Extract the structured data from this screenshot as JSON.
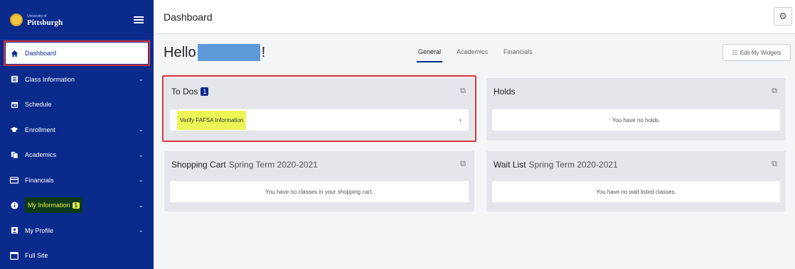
{
  "sidebar": {
    "logo_small": "University of",
    "logo_big": "Pittsburgh",
    "items": [
      {
        "label": "Dashboard"
      },
      {
        "label": "Class Information"
      },
      {
        "label": "Schedule"
      },
      {
        "label": "Enrollment"
      },
      {
        "label": "Academics"
      },
      {
        "label": "Financials"
      },
      {
        "label": "My Information",
        "badge": "1"
      },
      {
        "label": "My Profile"
      },
      {
        "label": "Full Site"
      }
    ]
  },
  "topbar": {
    "title": "Dashboard"
  },
  "main": {
    "greeting_prefix": "Hello",
    "greeting_suffix": "!",
    "tabs": [
      {
        "label": "General"
      },
      {
        "label": "Academics"
      },
      {
        "label": "Financials"
      }
    ],
    "edit_widgets_label": "Edit My Widgets",
    "cards": {
      "todos": {
        "title": "To Dos",
        "count": "1",
        "item": "Verify FAFSA Information"
      },
      "holds": {
        "title": "Holds",
        "empty": "You have no holds."
      },
      "cart": {
        "title": "Shopping Cart",
        "term": "Spring Term 2020-2021",
        "empty": "You have no classes in your shopping cart."
      },
      "waitlist": {
        "title": "Wait List",
        "term": "Spring Term 2020-2021",
        "empty": "You have no wait listed classes."
      }
    }
  },
  "colors": {
    "sidebar": "#0a2a8c",
    "highlight": "#ecf556",
    "annotation": "#d9353b"
  }
}
